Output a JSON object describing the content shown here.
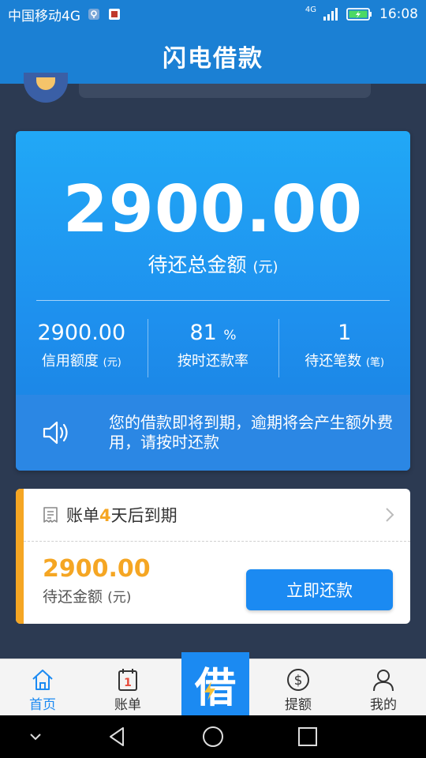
{
  "status_bar": {
    "carrier": "中国移动4G",
    "network_label": "4G",
    "time": "16:08"
  },
  "header": {
    "title": "闪电借款"
  },
  "summary": {
    "total_amount": "2900.00",
    "total_label": "待还总金额",
    "total_unit": "(元)",
    "stats": [
      {
        "value": "2900.00",
        "unit": "",
        "label": "信用额度",
        "label_unit": "(元)"
      },
      {
        "value": "81",
        "unit": "%",
        "label": "按时还款率",
        "label_unit": ""
      },
      {
        "value": "1",
        "unit": "",
        "label": "待还笔数",
        "label_unit": "(笔)"
      }
    ],
    "notice": "您的借款即将到期，逾期将会产生额外费用，请按时还款"
  },
  "bill": {
    "title_prefix": "账单",
    "days": "4",
    "title_suffix": "天后到期",
    "amount": "2900.00",
    "amount_label": "待还金额",
    "amount_unit": "(元)",
    "action_label": "立即还款"
  },
  "tabs": {
    "home": "首页",
    "bill": "账单",
    "bill_icon_number": "1",
    "borrow": "借",
    "limit": "提额",
    "mine": "我的"
  },
  "colors": {
    "brand_blue": "#1b80d4",
    "card_blue": "#21a8f6",
    "accent_orange": "#f5a623",
    "button_blue": "#1b8af2",
    "page_bg": "#2c3a52"
  }
}
